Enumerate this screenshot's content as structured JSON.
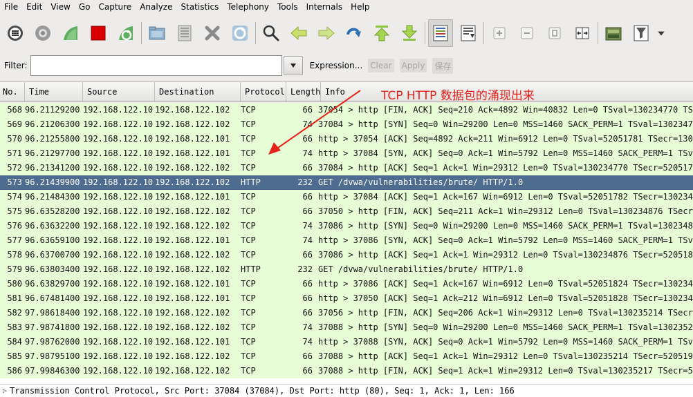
{
  "menu": [
    "File",
    "Edit",
    "View",
    "Go",
    "Capture",
    "Analyze",
    "Statistics",
    "Telephony",
    "Tools",
    "Internals",
    "Help"
  ],
  "filter": {
    "label": "Filter:",
    "value": "",
    "expression_label": "Expression...",
    "clear_label": "Clear",
    "apply_label": "Apply",
    "save_label": "保存"
  },
  "columns": [
    "No.",
    "Time",
    "Source",
    "Destination",
    "Protocol",
    "Length",
    "Info"
  ],
  "packets": [
    {
      "no": "568",
      "time": "96.21129200",
      "src": "192.168.122.10",
      "dst": "192.168.122.102",
      "proto": "TCP",
      "len": "66",
      "info": "37054 > http [FIN, ACK] Seq=210 Ack=4892 Win=40832 Len=0 TSval=130234770 TSe"
    },
    {
      "no": "569",
      "time": "96.21206300",
      "src": "192.168.122.10",
      "dst": "192.168.122.102",
      "proto": "TCP",
      "len": "74",
      "info": "37084 > http [SYN] Seq=0 Win=29200 Len=0 MSS=1460 SACK_PERM=1 TSval=13023477"
    },
    {
      "no": "570",
      "time": "96.21255800",
      "src": "192.168.122.10",
      "dst": "192.168.122.101",
      "proto": "TCP",
      "len": "66",
      "info": "http > 37054 [ACK] Seq=4892 Ack=211 Win=6912 Len=0 TSval=52051781 TSecr=1302"
    },
    {
      "no": "571",
      "time": "96.21297700",
      "src": "192.168.122.10",
      "dst": "192.168.122.101",
      "proto": "TCP",
      "len": "74",
      "info": "http > 37084 [SYN, ACK] Seq=0 Ack=1 Win=5792 Len=0 MSS=1460 SACK_PERM=1 TSva"
    },
    {
      "no": "572",
      "time": "96.21341200",
      "src": "192.168.122.10",
      "dst": "192.168.122.102",
      "proto": "TCP",
      "len": "66",
      "info": "37084 > http [ACK] Seq=1 Ack=1 Win=29312 Len=0 TSval=130234770 TSecr=5205178"
    },
    {
      "no": "573",
      "time": "96.21439900",
      "src": "192.168.122.10",
      "dst": "192.168.122.102",
      "proto": "HTTP",
      "len": "232",
      "info": "GET /dvwa/vulnerabilities/brute/ HTTP/1.0",
      "selected": true
    },
    {
      "no": "574",
      "time": "96.21484300",
      "src": "192.168.122.10",
      "dst": "192.168.122.101",
      "proto": "TCP",
      "len": "66",
      "info": "http > 37084 [ACK] Seq=1 Ack=167 Win=6912 Len=0 TSval=52051782 TSecr=1302347"
    },
    {
      "no": "575",
      "time": "96.63528200",
      "src": "192.168.122.10",
      "dst": "192.168.122.102",
      "proto": "TCP",
      "len": "66",
      "info": "37050 > http [FIN, ACK] Seq=211 Ack=1 Win=29312 Len=0 TSval=130234876 TSecr="
    },
    {
      "no": "576",
      "time": "96.63632200",
      "src": "192.168.122.10",
      "dst": "192.168.122.102",
      "proto": "TCP",
      "len": "74",
      "info": "37086 > http [SYN] Seq=0 Win=29200 Len=0 MSS=1460 SACK_PERM=1 TSval=13023487"
    },
    {
      "no": "577",
      "time": "96.63659100",
      "src": "192.168.122.10",
      "dst": "192.168.122.101",
      "proto": "TCP",
      "len": "74",
      "info": "http > 37086 [SYN, ACK] Seq=0 Ack=1 Win=5792 Len=0 MSS=1460 SACK_PERM=1 TSva"
    },
    {
      "no": "578",
      "time": "96.63700700",
      "src": "192.168.122.10",
      "dst": "192.168.122.102",
      "proto": "TCP",
      "len": "66",
      "info": "37086 > http [ACK] Seq=1 Ack=1 Win=29312 Len=0 TSval=130234876 TSecr=5205182"
    },
    {
      "no": "579",
      "time": "96.63803400",
      "src": "192.168.122.10",
      "dst": "192.168.122.102",
      "proto": "HTTP",
      "len": "232",
      "info": "GET /dvwa/vulnerabilities/brute/ HTTP/1.0"
    },
    {
      "no": "580",
      "time": "96.63829700",
      "src": "192.168.122.10",
      "dst": "192.168.122.101",
      "proto": "TCP",
      "len": "66",
      "info": "http > 37086 [ACK] Seq=1 Ack=167 Win=6912 Len=0 TSval=52051824 TSecr=1302348"
    },
    {
      "no": "581",
      "time": "96.67481400",
      "src": "192.168.122.10",
      "dst": "192.168.122.101",
      "proto": "TCP",
      "len": "66",
      "info": "http > 37050 [ACK] Seq=1 Ack=212 Win=6912 Len=0 TSval=52051828 TSecr=1302348"
    },
    {
      "no": "582",
      "time": "97.98618400",
      "src": "192.168.122.10",
      "dst": "192.168.122.102",
      "proto": "TCP",
      "len": "66",
      "info": "37056 > http [FIN, ACK] Seq=206 Ack=1 Win=29312 Len=0 TSval=130235214 TSecr="
    },
    {
      "no": "583",
      "time": "97.98741800",
      "src": "192.168.122.10",
      "dst": "192.168.122.102",
      "proto": "TCP",
      "len": "74",
      "info": "37088 > http [SYN] Seq=0 Win=29200 Len=0 MSS=1460 SACK_PERM=1 TSval=13023521"
    },
    {
      "no": "584",
      "time": "97.98762000",
      "src": "192.168.122.10",
      "dst": "192.168.122.101",
      "proto": "TCP",
      "len": "74",
      "info": "http > 37088 [SYN, ACK] Seq=0 Ack=1 Win=5792 Len=0 MSS=1460 SACK_PERM=1 TSva"
    },
    {
      "no": "585",
      "time": "97.98795100",
      "src": "192.168.122.10",
      "dst": "192.168.122.102",
      "proto": "TCP",
      "len": "66",
      "info": "37088 > http [ACK] Seq=1 Ack=1 Win=29312 Len=0 TSval=130235214 TSecr=5205195"
    },
    {
      "no": "586",
      "time": "97.99846300",
      "src": "192.168.122.10",
      "dst": "192.168.122.102",
      "proto": "TCP",
      "len": "66",
      "info": "37088 > http [FIN, ACK] Seq=1 Ack=1 Win=29312 Len=0 TSval=130235217 TSecr=52"
    }
  ],
  "detail": "Transmission Control Protocol, Src Port: 37084 (37084), Dst Port: http (80), Seq: 1, Ack: 1, Len: 166",
  "annotation": "TCP HTTP 数据包的涌现出来",
  "colors": {
    "row_bg": "#e6fdd6",
    "selected_bg": "#4e6c8f",
    "annotation": "#e3231c"
  },
  "toolbar_icons": [
    "interface-list-icon",
    "capture-options-icon",
    "start-capture-icon",
    "stop-capture-icon",
    "restart-capture-icon",
    "open-file-icon",
    "save-file-icon",
    "close-file-icon",
    "reload-icon",
    "find-packet-icon",
    "go-back-icon",
    "go-forward-icon",
    "go-to-packet-icon",
    "go-first-icon",
    "go-last-icon",
    "colorize-icon",
    "autoscroll-icon",
    "zoom-in-icon",
    "zoom-out-icon",
    "normal-size-icon",
    "resize-columns-icon",
    "capture-filters-icon",
    "display-filters-icon"
  ]
}
